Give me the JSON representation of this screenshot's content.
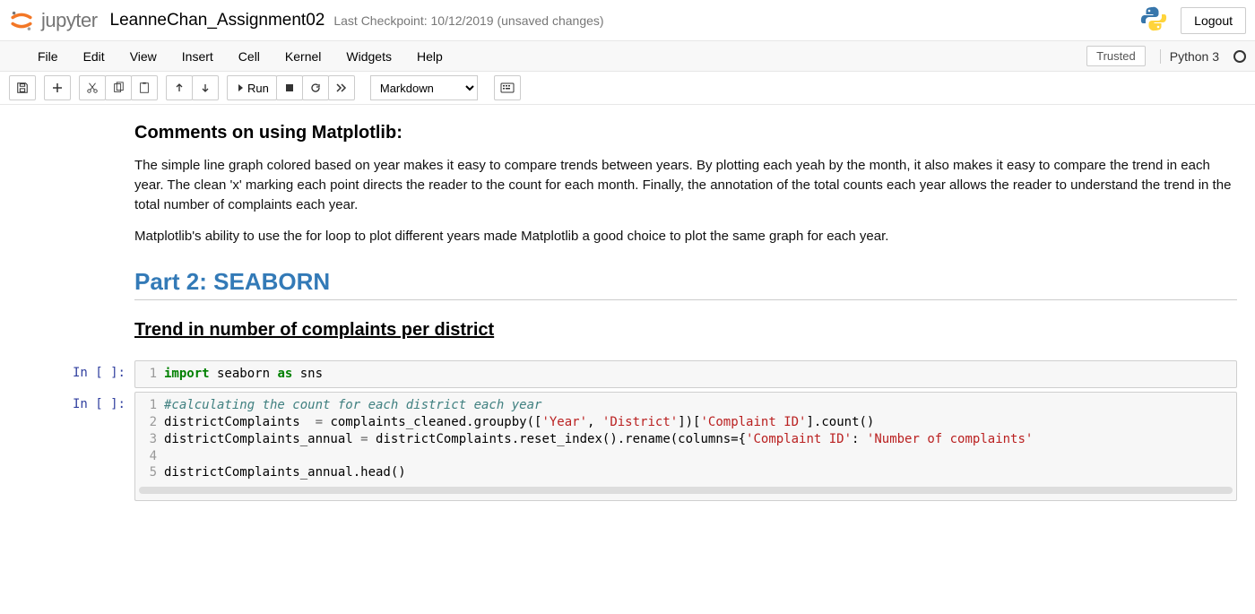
{
  "header": {
    "jupyter_text": "jupyter",
    "notebook_name": "LeanneChan_Assignment02",
    "checkpoint": "Last Checkpoint: 10/12/2019  (unsaved changes)",
    "logout": "Logout"
  },
  "menubar": {
    "items": [
      "File",
      "Edit",
      "View",
      "Insert",
      "Cell",
      "Kernel",
      "Widgets",
      "Help"
    ],
    "trusted": "Trusted",
    "kernel": "Python 3"
  },
  "toolbar": {
    "run_label": "Run",
    "celltype": "Markdown"
  },
  "content": {
    "md_heading": "Comments on using Matplotlib:",
    "md_para1": "The simple line graph colored based on year makes it easy to compare trends between years. By plotting each yeah by the month, it also makes it easy to compare the trend in each year. The clean 'x' marking each point directs the reader to the count for each month. Finally, the annotation of the total counts each year allows the reader to understand the trend in the total number of complaints each year.",
    "md_para2": "Matplotlib's ability to use the for loop to plot different years made Matplotlib a good choice to plot the same graph for each year.",
    "md_h2": "Part 2: SEABORN",
    "md_h3": "Trend in number of complaints per district",
    "prompt_in": "In [ ]:",
    "code1": {
      "lines": [
        1
      ],
      "import": "import",
      "seaborn": " seaborn ",
      "as": "as",
      "sns": " sns"
    },
    "code2": {
      "l1_comment": "#calculating the count for each district each year",
      "l2_p1": "districtComplaints  ",
      "l2_eq": "=",
      "l2_p2": " complaints_cleaned.groupby([",
      "l2_s1": "'Year'",
      "l2_c1": ", ",
      "l2_s2": "'District'",
      "l2_p3": "])[",
      "l2_s3": "'Complaint ID'",
      "l2_p4": "].count()",
      "l3_p1": "districtComplaints_annual ",
      "l3_eq": "=",
      "l3_p2": " districtComplaints.reset_index().rename(columns={",
      "l3_s1": "'Complaint ID'",
      "l3_c1": ": ",
      "l3_s2": "'Number of complaints'",
      "l5": "districtComplaints_annual.head()"
    }
  }
}
